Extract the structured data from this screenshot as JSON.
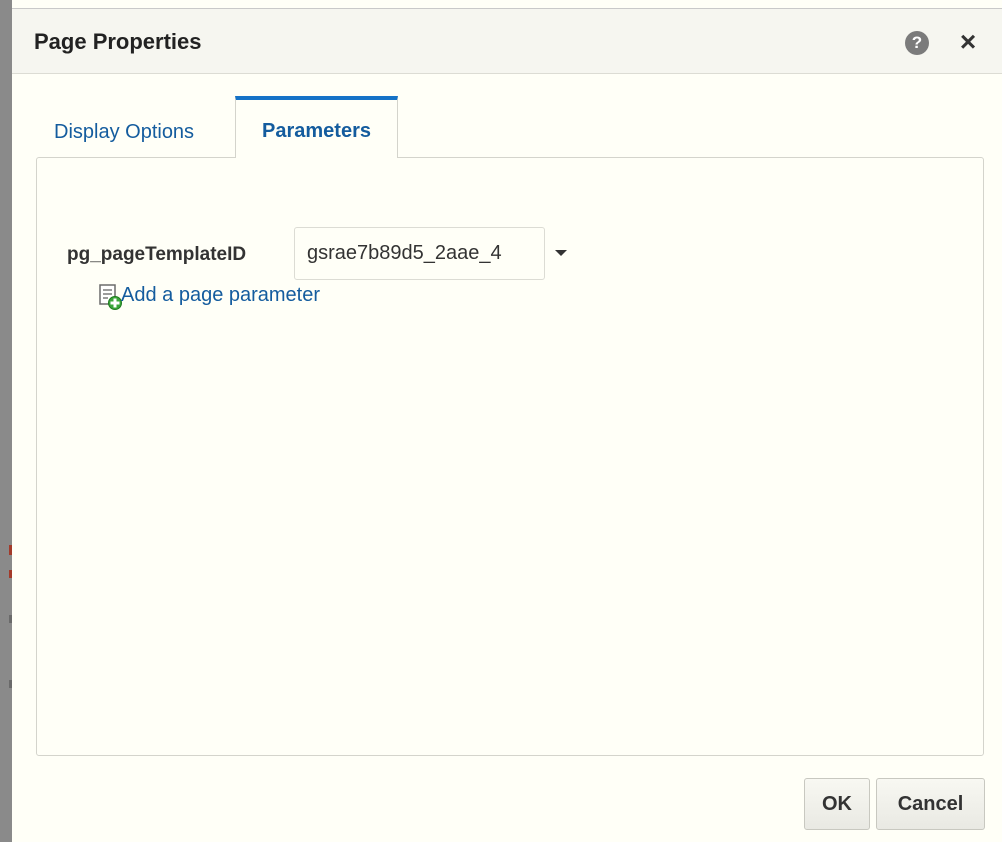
{
  "dialog": {
    "title": "Page Properties",
    "help_icon_glyph": "?",
    "close_icon_glyph": "×"
  },
  "tabs": [
    {
      "label": "Display Options",
      "selected": false
    },
    {
      "label": "Parameters",
      "selected": true
    }
  ],
  "parameters": {
    "label": "pg_pageTemplateID",
    "value": "gsrae7b89d5_2aae_4",
    "add_link_label": "Add a page parameter"
  },
  "buttons": {
    "ok_label": "OK",
    "cancel_label": "Cancel"
  },
  "colors": {
    "accent": "#1572c7",
    "link": "#145c9e",
    "background": "#fffff7"
  },
  "icons": {
    "help": "help-icon",
    "close": "close-icon",
    "add_parameter": "add-document-icon",
    "dropdown": "dropdown-arrow-icon"
  }
}
